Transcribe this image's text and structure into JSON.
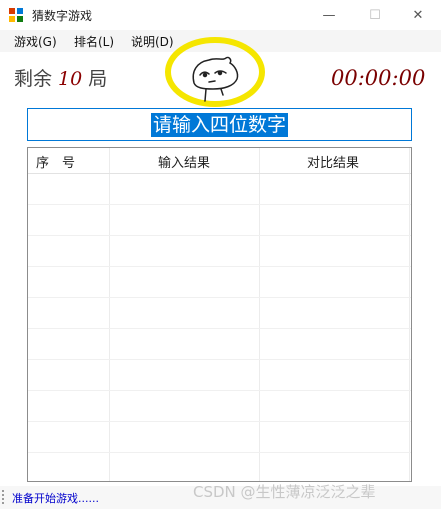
{
  "window": {
    "title": "猜数字游戏",
    "minimize_glyph": "—",
    "maximize_glyph": "☐",
    "close_glyph": "✕"
  },
  "menu": {
    "items": [
      {
        "label": "游戏(G)"
      },
      {
        "label": "排名(L)"
      },
      {
        "label": "说明(D)"
      }
    ]
  },
  "game": {
    "remaining_prefix": "剩余",
    "remaining_count": "10",
    "remaining_suffix": "局",
    "timer": "00:00:00"
  },
  "input": {
    "value": "请输入四位数字"
  },
  "table": {
    "columns": [
      "序　号",
      "输入结果",
      "对比结果"
    ],
    "rows": []
  },
  "status": {
    "text": "准备开始游戏......"
  },
  "watermark": "CSDN @生性薄凉泛泛之辈",
  "colors": {
    "accent": "#0078d7",
    "timer": "#7a0000",
    "status_text": "#0000cc",
    "highlight_circle": "#f5e600"
  },
  "icons": {
    "app": "app-grid-icon",
    "mascot": "mascot-face-icon"
  }
}
